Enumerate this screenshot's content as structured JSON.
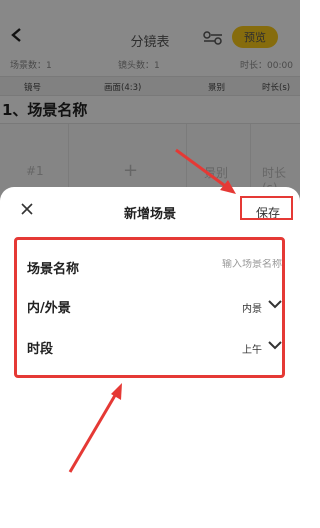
{
  "background": {
    "title": "分镜表",
    "preview_label": "预览",
    "stats": {
      "scene_count": "场景数：1",
      "shot_count": "镜头数：1",
      "duration": "时长：00:00"
    },
    "table_headers": [
      "镜号",
      "画面(4:3)",
      "景别",
      "时长(s)"
    ],
    "section_title": "1、场景名称",
    "shot_row": {
      "number": "#1",
      "add": "+",
      "shot_size": "景别",
      "duration": "时长(s)"
    }
  },
  "sheet": {
    "title": "新增场景",
    "save_label": "保存",
    "fields": {
      "name": {
        "label": "场景名称",
        "placeholder": "输入场景名称"
      },
      "location": {
        "label": "内/外景",
        "value": "内景"
      },
      "time": {
        "label": "时段",
        "value": "上午"
      }
    }
  },
  "colors": {
    "accent": "#f5c518",
    "annotation": "#e53935"
  }
}
